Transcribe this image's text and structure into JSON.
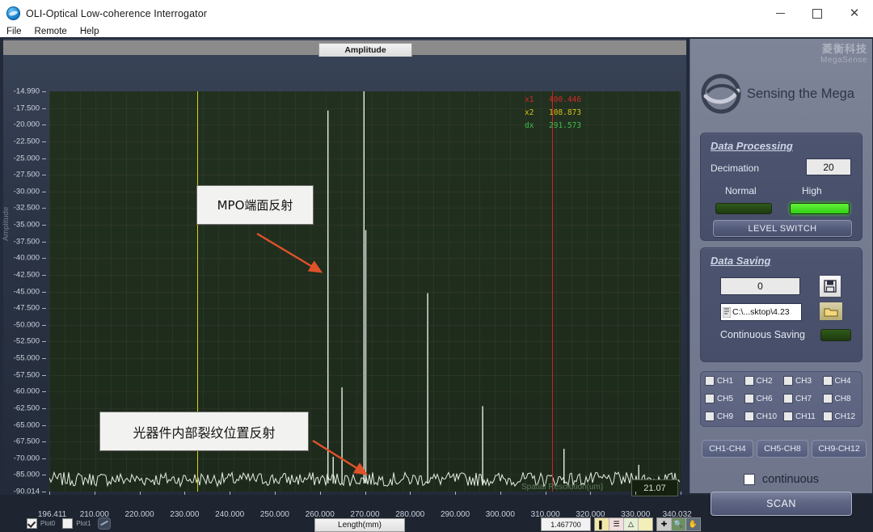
{
  "window": {
    "title": "OLI-Optical Low-coherence Interrogator",
    "app_icon": "app-globe-icon",
    "minimize": "–",
    "maximize": "□",
    "close": "✕"
  },
  "menu": {
    "items": [
      "File",
      "Remote",
      "Help"
    ]
  },
  "graph": {
    "tab_label": "Amplitude",
    "x_axis_label": "Length(mm)",
    "y_axis_label": "Amplitude",
    "y_ticks": [
      "-14.990",
      "-17.500",
      "-20.000",
      "-22.500",
      "-25.000",
      "-27.500",
      "-30.000",
      "-32.500",
      "-35.000",
      "-37.500",
      "-40.000",
      "-42.500",
      "-45.000",
      "-47.500",
      "-50.000",
      "-52.500",
      "-55.000",
      "-57.500",
      "-60.000",
      "-62.500",
      "-65.000",
      "-67.500",
      "-70.000",
      "-85.000",
      "-90.014"
    ],
    "x_ticks": [
      "196.411",
      "210.000",
      "220.000",
      "230.000",
      "240.000",
      "250.000",
      "260.000",
      "270.000",
      "280.000",
      "290.000",
      "300.000",
      "310.000",
      "320.000",
      "330.000",
      "340.032"
    ],
    "readout": [
      {
        "key": "x1",
        "value": "400.446",
        "color": "#cf2b2b"
      },
      {
        "key": "x2",
        "value": "108.873",
        "color": "#d4c018"
      },
      {
        "key": "dx",
        "value": "291.573",
        "color": "#3dbe4b"
      }
    ],
    "spatial_resolution_label": "Spatial Resolution(um)",
    "spatial_resolution_value": "21.07",
    "annotations": [
      {
        "id": "annot1",
        "text": "MPO端面反射"
      },
      {
        "id": "annot2",
        "text": "光器件内部裂纹位置反射"
      }
    ],
    "legend": [
      {
        "label": "Plot0",
        "checked": true
      },
      {
        "label": "Plot1",
        "checked": false
      }
    ],
    "toolbar_value": "1.467700",
    "toolbar_icons": [
      "cursor-palette-icon",
      "grid-style-icon",
      "waveform-icon",
      "highlight-icon",
      "crosshair-icon",
      "zoom-icon",
      "pan-hand-icon"
    ],
    "cursor_yellow_color": "#d8d800",
    "cursor_red_color": "#d02020",
    "plot_background": "#1e2a1c"
  },
  "chart_data": {
    "type": "line",
    "title": "Amplitude",
    "xlabel": "Length(mm)",
    "ylabel": "Amplitude",
    "xlim": [
      196.411,
      340.032
    ],
    "ylim": [
      -90.014,
      -14.99
    ],
    "grid": true,
    "legend": [
      "Plot0",
      "Plot1"
    ],
    "noise_floor_db": -88.5,
    "series": [
      {
        "name": "Plot0",
        "color": "#e8efe6",
        "peaks": [
          {
            "x": 259.8,
            "y": -18.6,
            "note": "MPO end-face reflection"
          },
          {
            "x": 268.0,
            "y": -14.9
          },
          {
            "x": 268.4,
            "y": -41.0
          },
          {
            "x": 282.5,
            "y": -52.8
          },
          {
            "x": 263.0,
            "y": -70.5
          },
          {
            "x": 295.0,
            "y": -74.0
          },
          {
            "x": 261.0,
            "y": -83.5,
            "note": "internal crack reflection"
          },
          {
            "x": 313.5,
            "y": -82.0
          },
          {
            "x": 330.5,
            "y": -85.0
          }
        ]
      }
    ],
    "cursors": [
      {
        "name": "x2",
        "x": 230.0,
        "color": "#d8d800"
      },
      {
        "name": "x1",
        "x": 310.8,
        "color": "#d02020"
      }
    ],
    "annotations": [
      {
        "text": "MPO端面反射",
        "points_to_x": 259.8
      },
      {
        "text": "光器件内部裂纹位置反射",
        "points_to_x": 261.0
      }
    ]
  },
  "sidebar": {
    "watermark_cn": "菱衡科技",
    "watermark_en": "MegaSense",
    "brand_text": "Sensing the Mega",
    "data_processing": {
      "title": "Data Processing",
      "decimation_label": "Decimation",
      "decimation_value": "20",
      "normal_label": "Normal",
      "high_label": "High",
      "normal_on": false,
      "high_on": true,
      "level_switch_label": "LEVEL  SWITCH"
    },
    "data_saving": {
      "title": "Data Saving",
      "count_value": "0",
      "save_icon": "floppy-disk-icon",
      "path_value": "C:\\...sktop\\4.23",
      "browse_icon": "folder-open-icon",
      "continuous_saving_label": "Continuous  Saving",
      "continuous_saving_on": false
    },
    "channels": [
      [
        "CH1",
        "CH2",
        "CH3",
        "CH4"
      ],
      [
        "CH5",
        "CH6",
        "CH7",
        "CH8"
      ],
      [
        "CH9",
        "CH10",
        "CH11",
        "CH12"
      ]
    ],
    "channel_groups": [
      "CH1-CH4",
      "CH5-CH8",
      "CH9-CH12"
    ],
    "continuous_label": "continuous",
    "continuous_checked": false,
    "scan_label": "SCAN"
  }
}
